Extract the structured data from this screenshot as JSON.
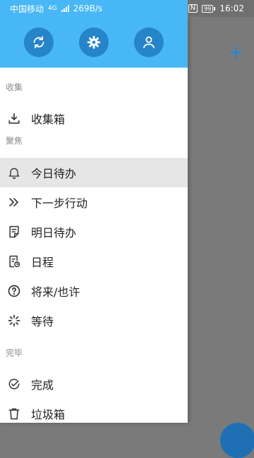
{
  "status_bar": {
    "carrier": "中国移动",
    "network": "4G",
    "speed": "269B/s",
    "nfc": "N",
    "battery": "99",
    "time": "16:02"
  },
  "header": {
    "buttons": [
      {
        "icon": "sync-icon"
      },
      {
        "icon": "gear-icon"
      },
      {
        "icon": "user-icon"
      }
    ]
  },
  "sections": {
    "collect": "收集",
    "focus": "聚焦",
    "done": "完毕"
  },
  "menu": {
    "inbox": "收集箱",
    "today": "今日待办",
    "next_action": "下一步行动",
    "tomorrow": "明日待办",
    "schedule": "日程",
    "someday": "将来/也许",
    "waiting": "等待",
    "completed": "完成",
    "trash": "垃圾箱"
  },
  "colors": {
    "header_blue": "#47b8f5",
    "button_blue": "#2684c8",
    "active_bg": "#e6e6e6"
  }
}
